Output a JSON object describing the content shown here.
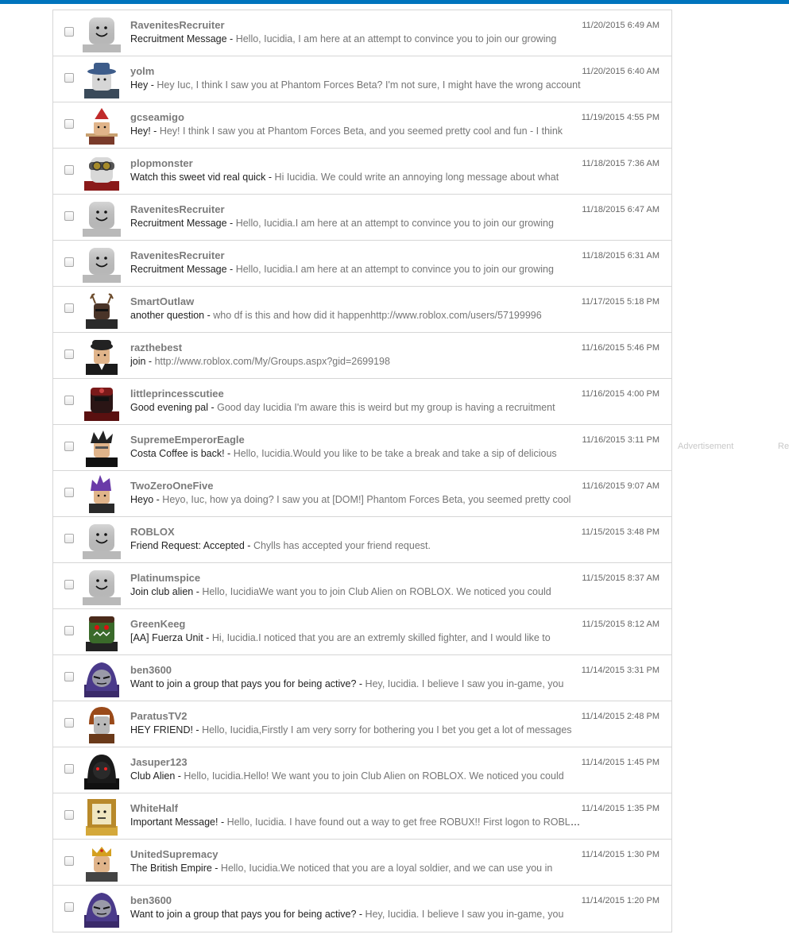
{
  "sidebar": {
    "ad_label": "Advertisement",
    "ad_cut_label": "Re"
  },
  "messages": [
    {
      "sender": "RavenitesRecruiter",
      "subject": "Recruitment Message - ",
      "preview": "Hello, Iucidia, I am here at an attempt to convince you to join our growing",
      "date": "11/20/2015 6:49 AM",
      "avatar": "default"
    },
    {
      "sender": "yolm",
      "subject": "Hey - ",
      "preview": "Hey Iuc, I think I saw you at Phantom Forces Beta? I'm not sure, I might have the wrong account",
      "date": "11/20/2015 6:40 AM",
      "avatar": "hat-blue"
    },
    {
      "sender": "gcseamigo",
      "subject": "Hey! - ",
      "preview": "Hey! I think I saw you at Phantom Forces Beta, and you seemed pretty cool and fun - I think",
      "date": "11/19/2015 4:55 PM",
      "avatar": "santa"
    },
    {
      "sender": "plopmonster",
      "subject": "Watch this sweet vid real quick - ",
      "preview": "Hi Iucidia. We could write an annoying long message about what",
      "date": "11/18/2015 7:36 AM",
      "avatar": "goggles"
    },
    {
      "sender": "RavenitesRecruiter",
      "subject": "Recruitment Message - ",
      "preview": "Hello, Iucidia.I am here at an attempt to convince you to join our growing",
      "date": "11/18/2015 6:47 AM",
      "avatar": "default"
    },
    {
      "sender": "RavenitesRecruiter",
      "subject": "Recruitment Message - ",
      "preview": "Hello, Iucidia.I am here at an attempt to convince you to join our growing",
      "date": "11/18/2015 6:31 AM",
      "avatar": "default"
    },
    {
      "sender": "SmartOutlaw",
      "subject": "another question - ",
      "preview": "who df is this and how did it happenhttp://www.roblox.com/users/57199996",
      "date": "11/17/2015 5:18 PM",
      "avatar": "antlers"
    },
    {
      "sender": "razthebest",
      "subject": "join - ",
      "preview": "http://www.roblox.com/My/Groups.aspx?gid=2699198",
      "date": "11/16/2015 5:46 PM",
      "avatar": "officer"
    },
    {
      "sender": "littleprincesscutiee",
      "subject": "Good evening pal - ",
      "preview": "Good day Iucidia I'm aware this is weird but my group is having a recruitment",
      "date": "11/16/2015 4:00 PM",
      "avatar": "masked-red"
    },
    {
      "sender": "SupremeEmperorEagle",
      "subject": "Costa Coffee is back! - ",
      "preview": "Hello, Iucidia.Would you like to be take a break and take a sip of delicious",
      "date": "11/16/2015 3:11 PM",
      "avatar": "spiky"
    },
    {
      "sender": "TwoZeroOneFive",
      "subject": "Heyo - ",
      "preview": "Heyo, Iuc, how ya doing? I saw you at [DOM!] Phantom Forces Beta, you seemed pretty cool",
      "date": "11/16/2015 9:07 AM",
      "avatar": "purple-hair"
    },
    {
      "sender": "ROBLOX",
      "subject": "Friend Request: Accepted - ",
      "preview": "Chylls has accepted your friend request.",
      "date": "11/15/2015 3:48 PM",
      "avatar": "default"
    },
    {
      "sender": "Platinumspice",
      "subject": "Join club alien - ",
      "preview": "Hello, IucidiaWe want you to join Club Alien on ROBLOX. We noticed you could",
      "date": "11/15/2015 8:37 AM",
      "avatar": "default"
    },
    {
      "sender": "GreenKeeg",
      "subject": "[AA] Fuerza Unit - ",
      "preview": "Hi, Iucidia.I noticed that you are an extremly skilled fighter, and I would like to",
      "date": "11/15/2015 8:12 AM",
      "avatar": "green-monster"
    },
    {
      "sender": "ben3600",
      "subject": "Want to join a group that pays you for being active? - ",
      "preview": "Hey, Iucidia. I believe I saw you in-game, you",
      "date": "11/14/2015 3:31 PM",
      "avatar": "raven"
    },
    {
      "sender": "ParatusTV2",
      "subject": "HEY FRIEND! - ",
      "preview": "Hello, Iucidia,Firstly I am very sorry for bothering you I bet you get a lot of messages",
      "date": "11/14/2015 2:48 PM",
      "avatar": "brown-hair"
    },
    {
      "sender": "Jasuper123",
      "subject": "Club Alien - ",
      "preview": "Hello, Iucidia.Hello! We want you to join Club Alien on ROBLOX. We noticed you could",
      "date": "11/14/2015 1:45 PM",
      "avatar": "dark-hood"
    },
    {
      "sender": "WhiteHalf",
      "subject": "Important Message! - ",
      "preview": "Hello, Iucidia. I have found out a way to get free ROBUX!! First logon to ROBLOX",
      "date": "11/14/2015 1:35 PM",
      "avatar": "box-head"
    },
    {
      "sender": "UnitedSupremacy",
      "subject": "The British Empire - ",
      "preview": "Hello, Iucidia.We noticed that you are a loyal soldier, and we can use you in",
      "date": "11/14/2015 1:30 PM",
      "avatar": "crown"
    },
    {
      "sender": "ben3600",
      "subject": "Want to join a group that pays you for being active? - ",
      "preview": "Hey, Iucidia. I believe I saw you in-game, you",
      "date": "11/14/2015 1:20 PM",
      "avatar": "raven"
    }
  ]
}
